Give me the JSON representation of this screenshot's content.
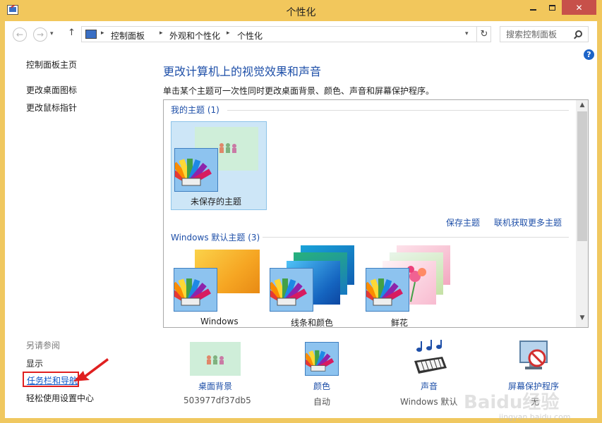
{
  "window": {
    "title": "个性化",
    "close_label": "✕"
  },
  "address": {
    "breadcrumbs": [
      "控制面板",
      "外观和个性化",
      "个性化"
    ],
    "search_placeholder": "搜索控制面板"
  },
  "sidebar": {
    "home": "控制面板主页",
    "links": [
      "更改桌面图标",
      "更改鼠标指针"
    ],
    "see_also_heading": "另请参阅",
    "see_also": [
      "显示",
      "任务栏和导航",
      "轻松使用设置中心"
    ]
  },
  "main": {
    "title": "更改计算机上的视觉效果和声音",
    "description": "单击某个主题可一次性同时更改桌面背景、颜色、声音和屏幕保护程序。",
    "my_themes_heading": "我的主题 (1)",
    "unsaved_theme": "未保存的主题",
    "save_theme": "保存主题",
    "get_more_themes": "联机获取更多主题",
    "default_themes_heading": "Windows 默认主题 (3)",
    "default_themes": [
      "Windows",
      "线条和颜色",
      "鲜花"
    ]
  },
  "bottom": [
    {
      "label": "桌面背景",
      "value": "503977df37db5"
    },
    {
      "label": "颜色",
      "value": "自动"
    },
    {
      "label": "声音",
      "value": "Windows 默认"
    },
    {
      "label": "屏幕保护程序",
      "value": "无"
    }
  ],
  "watermark": {
    "text": "Baidu经验",
    "sub": "jingyan.baidu.com"
  },
  "colors": {
    "link": "#1e4fa8",
    "titlebar": "#f2c75c",
    "highlight": "#e02020",
    "close": "#c7504a"
  }
}
